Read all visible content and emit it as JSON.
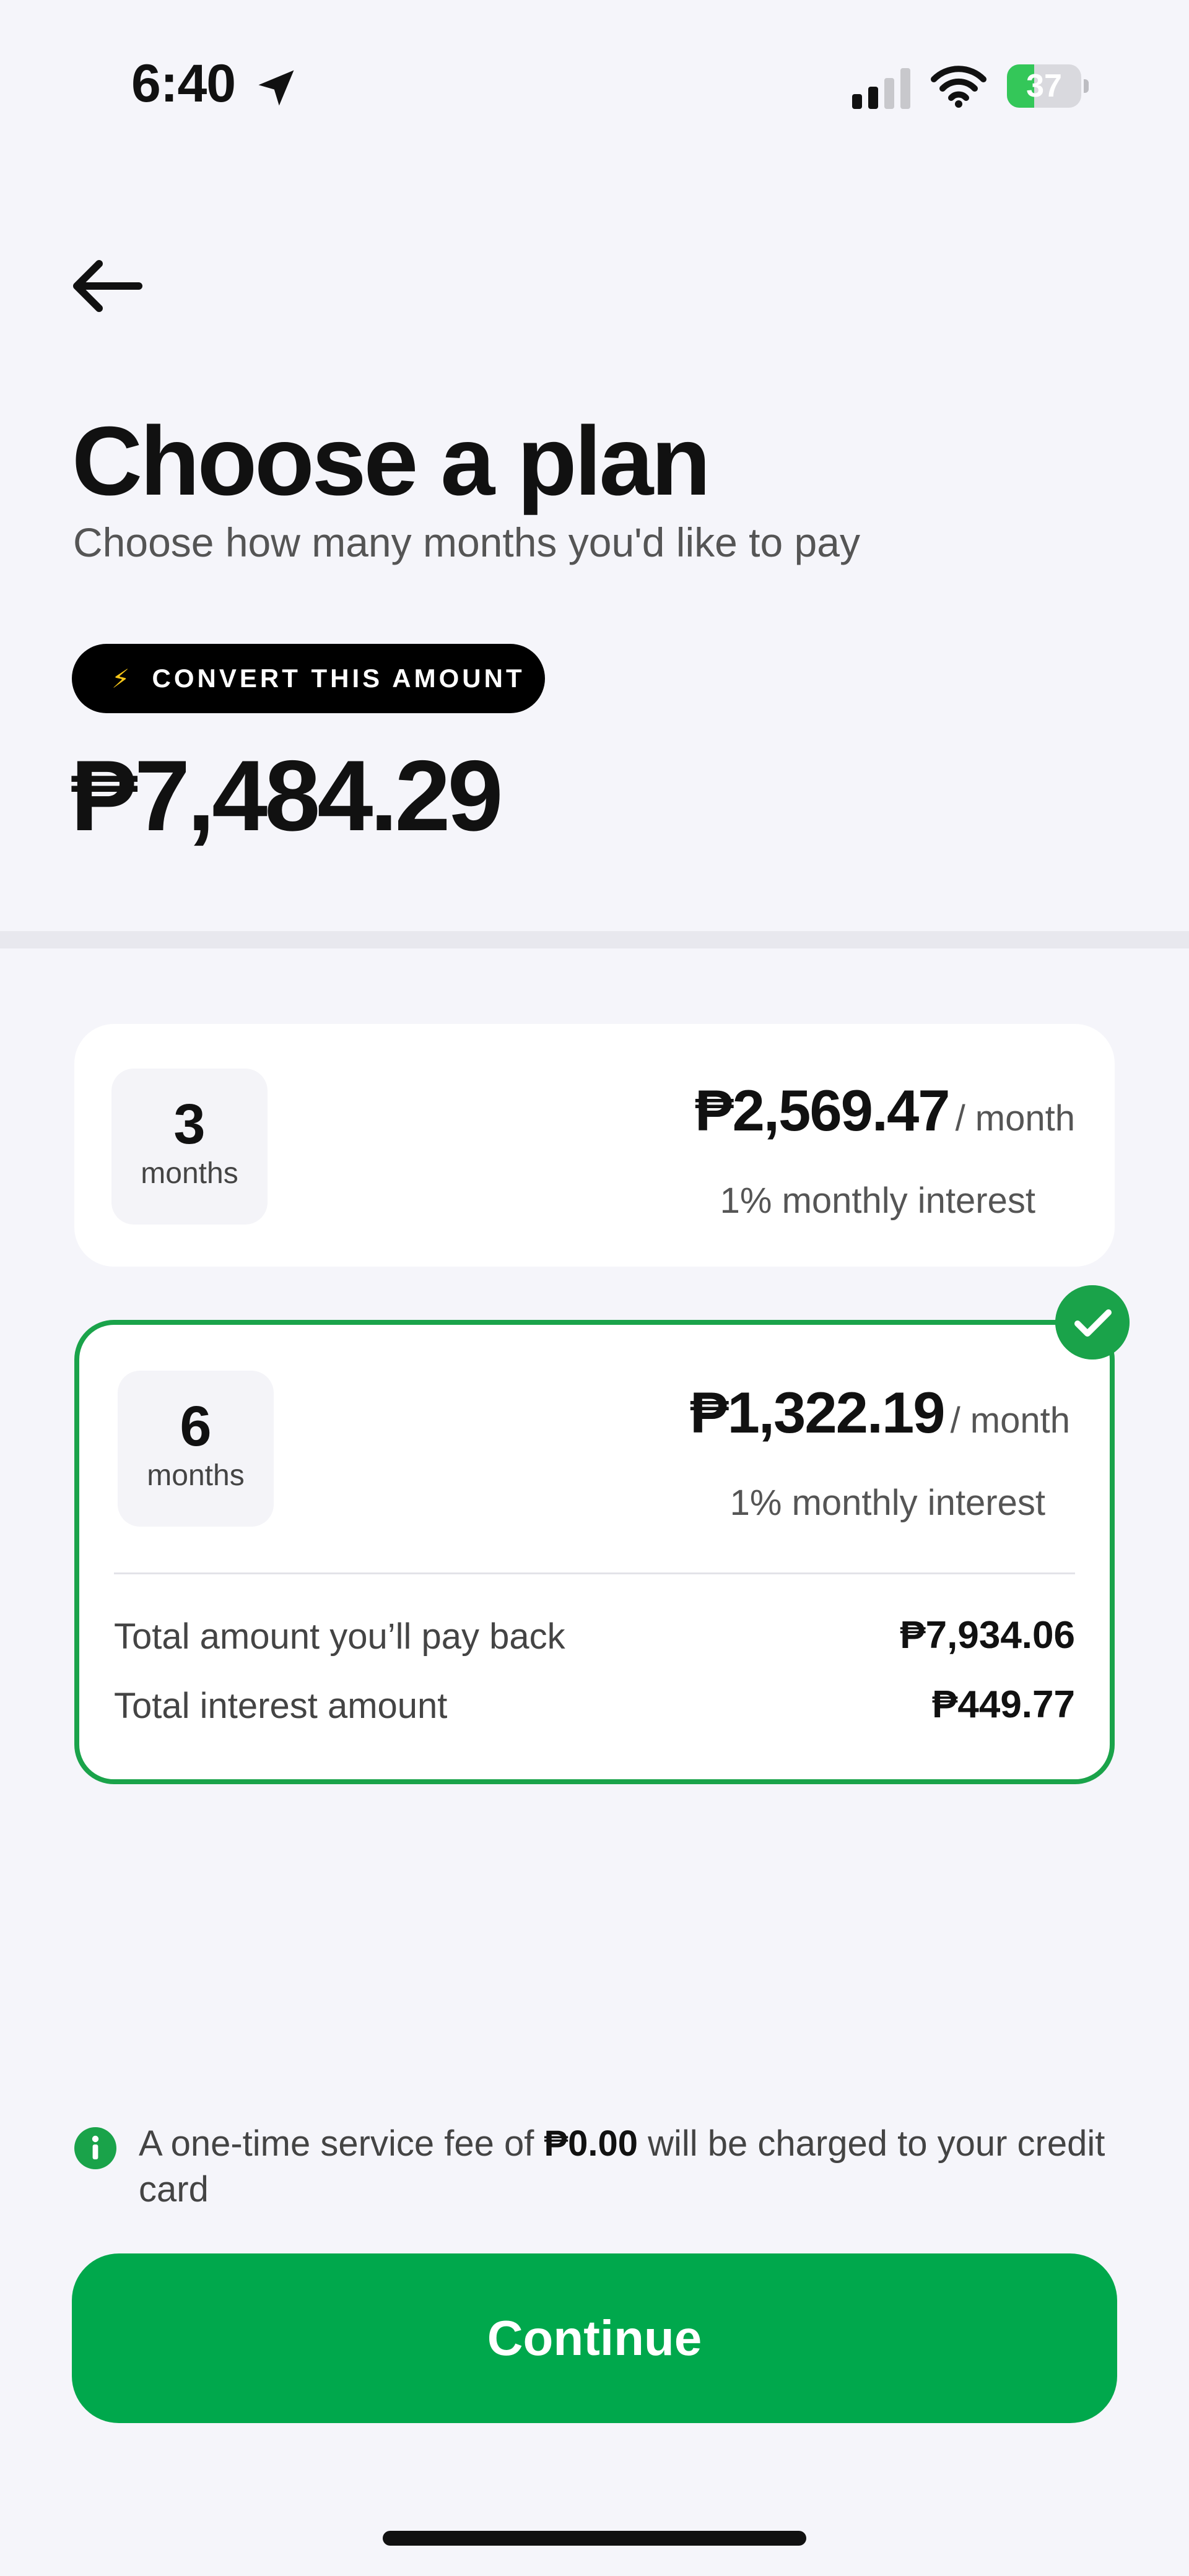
{
  "status_bar": {
    "time": "6:40",
    "battery_level": "37",
    "battery_fill_fraction": 0.37,
    "battery_color": "#34c759",
    "icons": [
      "location-arrow-icon",
      "cellular-signal-icon",
      "wifi-icon",
      "battery-charging-icon"
    ]
  },
  "header": {
    "back_icon": "arrow-left-icon",
    "title": "Choose a plan",
    "subtitle": "Choose how many months you'd like to pay"
  },
  "convert": {
    "bolt_icon": "⚡",
    "label": "CONVERT THIS AMOUNT",
    "amount": "₱7,484.29"
  },
  "plans": [
    {
      "months": "3",
      "months_label": "months",
      "monthly_price": "₱2,569.47",
      "per": "/ month",
      "interest": "1% monthly interest",
      "selected": false
    },
    {
      "months": "6",
      "months_label": "months",
      "monthly_price": "₱1,322.19",
      "per": "/ month",
      "interest": "1% monthly interest",
      "selected": true,
      "total_payback_label": "Total amount you’ll pay back",
      "total_payback_value": "₱7,934.06",
      "total_interest_label": "Total interest amount",
      "total_interest_value": "₱449.77"
    }
  ],
  "notice": {
    "icon": "info-icon",
    "text_before": "A one-time service fee of ",
    "fee": "₱0.00",
    "text_after": " will be charged to your credit card"
  },
  "continue_label": "Continue",
  "colors": {
    "accent_green": "#00a84c",
    "selected_border": "#1aa34a",
    "background": "#f5f5fa"
  }
}
